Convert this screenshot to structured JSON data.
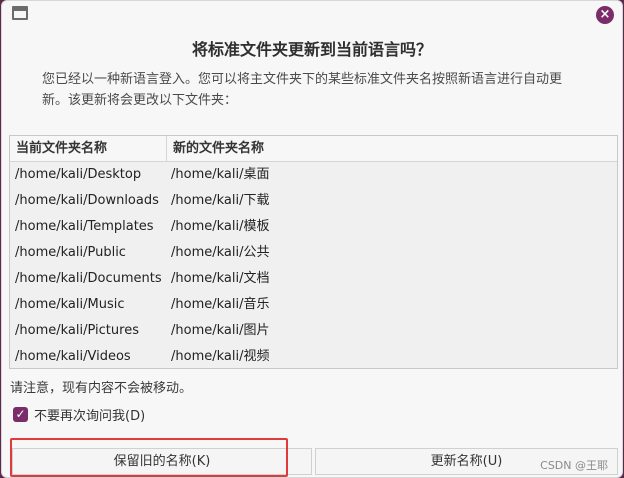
{
  "dialog": {
    "title": "将标准文件夹更新到当前语言吗？",
    "description": "您已经以一种新语言登入。您可以将主文件夹下的某些标准文件夹名按照新语言进行自动更新。该更新将会更改以下文件夹：",
    "close_icon": "×",
    "table": {
      "headers": [
        "当前文件夹名称",
        "新的文件夹名称"
      ],
      "rows": [
        [
          "/home/kali/Desktop",
          "/home/kali/桌面"
        ],
        [
          "/home/kali/Downloads",
          "/home/kali/下载"
        ],
        [
          "/home/kali/Templates",
          "/home/kali/模板"
        ],
        [
          "/home/kali/Public",
          "/home/kali/公共"
        ],
        [
          "/home/kali/Documents",
          "/home/kali/文档"
        ],
        [
          "/home/kali/Music",
          "/home/kali/音乐"
        ],
        [
          "/home/kali/Pictures",
          "/home/kali/图片"
        ],
        [
          "/home/kali/Videos",
          "/home/kali/视频"
        ]
      ]
    },
    "note": "请注意，现有内容不会被移动。",
    "checkbox": {
      "label": "不要再次询问我(D)",
      "checked": true,
      "check_glyph": "✓"
    },
    "buttons": {
      "keep": "保留旧的名称(K)",
      "update": "更新名称(U)"
    },
    "watermark": "CSDN @王耶"
  },
  "colors": {
    "accent": "#7b2d6b",
    "highlight": "#e03a3a"
  }
}
